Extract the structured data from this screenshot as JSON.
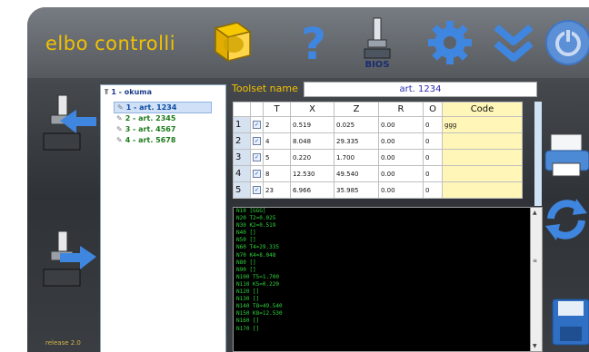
{
  "app": {
    "brand": "elbo controlli",
    "version": "release 2.0"
  },
  "toolbar": {
    "icons": [
      "cube-logo-icon",
      "help-question-icon",
      "bios-machine-icon",
      "settings-gear-icon",
      "chevron-down-double-icon",
      "power-icon"
    ],
    "bios_label": "BIOS"
  },
  "tree": {
    "root": "1 - okuma",
    "items": [
      "1 - art. 1234",
      "2 - art. 2345",
      "3 - art. 4567",
      "4 - art. 5678"
    ],
    "selected_index": 0
  },
  "toolset": {
    "label": "Toolset name",
    "value": "art. 1234"
  },
  "grid": {
    "headers": [
      "T",
      "X",
      "Z",
      "R",
      "O",
      "Code"
    ],
    "rows": [
      {
        "n": "1",
        "t": "2",
        "x": "0.519",
        "z": "0.025",
        "r": "0.00",
        "o": "0",
        "code": "ggg"
      },
      {
        "n": "2",
        "t": "4",
        "x": "8.048",
        "z": "29.335",
        "r": "0.00",
        "o": "0",
        "code": ""
      },
      {
        "n": "3",
        "t": "5",
        "x": "0.220",
        "z": "1.700",
        "r": "0.00",
        "o": "0",
        "code": ""
      },
      {
        "n": "4",
        "t": "8",
        "x": "12.530",
        "z": "49.540",
        "r": "0.00",
        "o": "0",
        "code": ""
      },
      {
        "n": "5",
        "t": "23",
        "x": "6.966",
        "z": "35.985",
        "r": "0.00",
        "o": "0",
        "code": ""
      }
    ]
  },
  "console": {
    "lines": [
      "N10 [GGG]",
      "N20 T2=0.025",
      "N30 K2=0.519",
      "N40 []",
      "N50 []",
      "N60 T4=29.335",
      "N70 K4=8.048",
      "N80 []",
      "N90 []",
      "N100 T5=1.700",
      "N110 K5=0.220",
      "N120 []",
      "N130 []",
      "N140 T8=49.540",
      "N150 K8=12.530",
      "N160 []",
      "N170 []"
    ]
  },
  "colors": {
    "brand": "#f1c100",
    "console_text": "#2fd43a",
    "selection": "#cfe0f7"
  }
}
